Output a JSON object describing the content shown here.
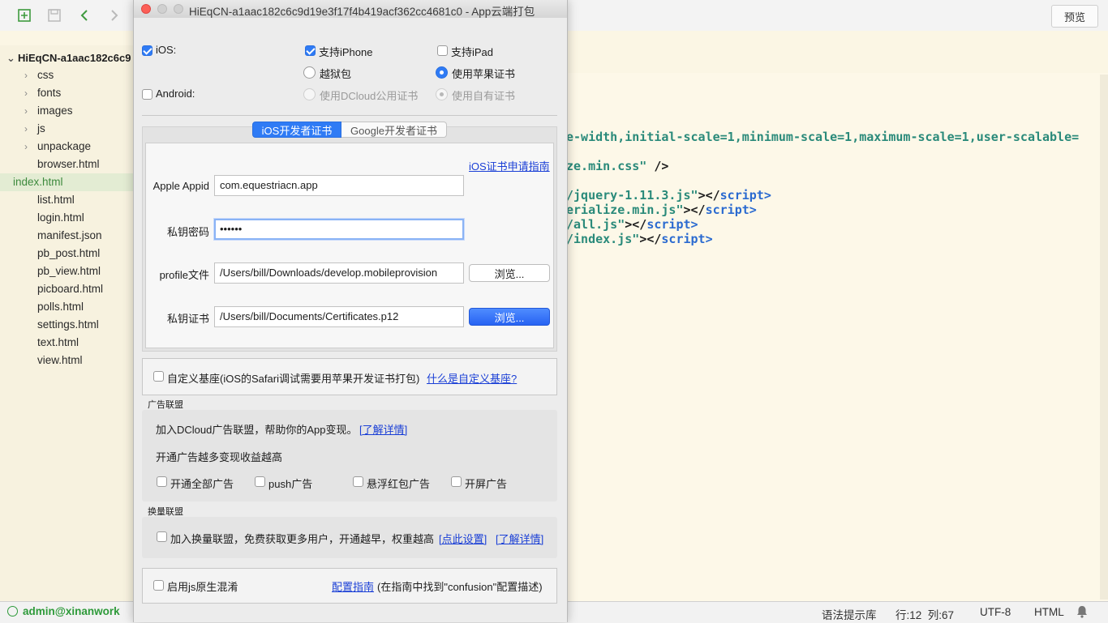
{
  "ide": {
    "preview_label": "预览",
    "project_name": "HiEqCN-a1aac182c6c9",
    "tree": [
      {
        "label": "css",
        "type": "folder"
      },
      {
        "label": "fonts",
        "type": "folder"
      },
      {
        "label": "images",
        "type": "folder"
      },
      {
        "label": "js",
        "type": "folder"
      },
      {
        "label": "unpackage",
        "type": "folder"
      },
      {
        "label": "browser.html",
        "type": "file"
      },
      {
        "label": "index.html",
        "type": "file",
        "selected": true
      },
      {
        "label": "list.html",
        "type": "file"
      },
      {
        "label": "login.html",
        "type": "file"
      },
      {
        "label": "manifest.json",
        "type": "file"
      },
      {
        "label": "pb_post.html",
        "type": "file"
      },
      {
        "label": "pb_view.html",
        "type": "file"
      },
      {
        "label": "picboard.html",
        "type": "file"
      },
      {
        "label": "polls.html",
        "type": "file"
      },
      {
        "label": "settings.html",
        "type": "file"
      },
      {
        "label": "text.html",
        "type": "file"
      },
      {
        "label": "view.html",
        "type": "file"
      }
    ],
    "code_lines": [
      {
        "a": "e-width,initial-scale=1,minimum-scale=1,maximum-scale=1,user-scalable=",
        "b": "",
        "c": ""
      },
      {
        "a": "ze.min.css\"",
        "b": "",
        "c": " />"
      },
      {
        "a": "/jquery-1.11.3.js\"",
        "b": "></",
        "c": "script>"
      },
      {
        "a": "erialize.min.js\"",
        "b": "></",
        "c": "script>"
      },
      {
        "a": "/all.js\"",
        "b": "></",
        "c": "script>"
      },
      {
        "a": "/index.js\"",
        "b": "></",
        "c": "script>"
      }
    ],
    "status": {
      "user": "admin@xinanwork",
      "syntax": "语法提示库",
      "position": "行:12  列:67",
      "encoding": "UTF-8",
      "language": "HTML"
    }
  },
  "dialog": {
    "title": "HiEqCN-a1aac182c6c9d19e3f17f4b419acf362cc4681c0 - App云端打包",
    "platform": {
      "ios_label": "iOS:",
      "ios_checked": true,
      "android_label": "Android:",
      "android_checked": false,
      "support_iphone": "支持iPhone",
      "support_ipad": "支持iPad",
      "jailbreak": "越狱包",
      "apple_cert": "使用苹果证书",
      "dcloud_cert": "使用DCloud公用证书",
      "own_cert": "使用自有证书"
    },
    "tabs": [
      "iOS开发者证书",
      "Google开发者证书"
    ],
    "ios_cert": {
      "guide_link": "iOS证书申请指南",
      "appid_label": "Apple Appid",
      "appid_value": "com.equestriacn.app",
      "password_label": "私钥密码",
      "password_value": "••••••",
      "profile_label": "profile文件",
      "profile_value": "/Users/bill/Downloads/develop.mobileprovision",
      "browse_label": "浏览...",
      "cert_label": "私钥证书",
      "cert_value": "/Users/bill/Documents/Certificates.p12",
      "browse2_label": "浏览..."
    },
    "custom_base": {
      "label": "自定义基座(iOS的Safari调试需要用苹果开发证书打包)",
      "link": "什么是自定义基座?"
    },
    "ad": {
      "section_title": "广告联盟",
      "intro": "加入DCloud广告联盟，帮助你的App变现。",
      "intro_link": "[了解详情]",
      "hint": "开通广告越多变现收益越高",
      "options": [
        "开通全部广告",
        "push广告",
        "悬浮红包广告",
        "开屏广告"
      ]
    },
    "exchange": {
      "section_title": "换量联盟",
      "label": "加入换量联盟，免费获取更多用户，开通越早，权重越高",
      "link_setup": "[点此设置]",
      "link_detail": "[了解详情]"
    },
    "confusion": {
      "label": "启用js原生混淆",
      "link": "配置指南",
      "note": "(在指南中找到\"confusion\"配置描述)"
    }
  },
  "colors": {
    "accent": "#2f7bf5",
    "link": "#1a3fd6",
    "user_green": "#2e9a3a"
  }
}
